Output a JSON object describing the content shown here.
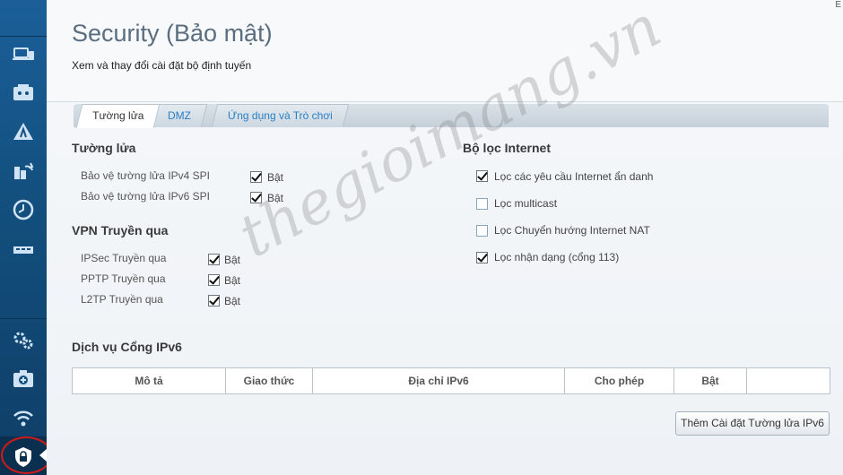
{
  "header": {
    "title": "Security (Bảo mật)",
    "subtitle": "Xem và thay đổi cài đặt bộ định tuyến",
    "corner_mark": "E"
  },
  "tabs": [
    {
      "label": "Tường lửa",
      "active": true
    },
    {
      "label": "DMZ",
      "active": false
    },
    {
      "label": "Ứng dụng và Trò chơi",
      "active": false
    }
  ],
  "firewall": {
    "title": "Tường lửa",
    "rows": [
      {
        "label": "Bảo vệ tường lửa IPv4 SPI",
        "checked": true,
        "value": "Bật"
      },
      {
        "label": "Bảo vệ tường lửa IPv6 SPI",
        "checked": true,
        "value": "Bật"
      }
    ]
  },
  "vpn": {
    "title": "VPN Truyền qua",
    "rows": [
      {
        "label": "IPSec Truyền qua",
        "checked": true,
        "value": "Bật"
      },
      {
        "label": "PPTP Truyền qua",
        "checked": true,
        "value": "Bật"
      },
      {
        "label": "L2TP Truyền qua",
        "checked": true,
        "value": "Bật"
      }
    ]
  },
  "internet_filter": {
    "title": "Bộ lọc Internet",
    "rows": [
      {
        "label": "Lọc các yêu cầu Internet ẩn danh",
        "checked": true
      },
      {
        "label": "Lọc multicast",
        "checked": false
      },
      {
        "label": "Lọc Chuyển hướng Internet NAT",
        "checked": false
      },
      {
        "label": "Lọc nhận dạng (cổng 113)",
        "checked": true
      }
    ]
  },
  "ipv6_service": {
    "title": "Dịch vụ Cổng IPv6",
    "columns": [
      "Mô tả",
      "Giao thức",
      "Địa chỉ IPv6",
      "Cho phép",
      "Bật",
      ""
    ],
    "add_button": "Thêm Cài đặt Tường lửa IPv6"
  },
  "watermark": "thegioimang.vn",
  "sidebar": {
    "icons": [
      "devices-icon",
      "parental-controls-icon",
      "wifi-signal-icon",
      "backup-restore-icon",
      "clock-icon",
      "usb-icon",
      "settings-gears-icon",
      "troubleshooting-icon",
      "wireless-icon",
      "security-lock-icon"
    ]
  },
  "colors": {
    "sidebar": "#13507f",
    "accent_tab": "#2a7fc2",
    "highlight_circle": "#d11a1a"
  }
}
